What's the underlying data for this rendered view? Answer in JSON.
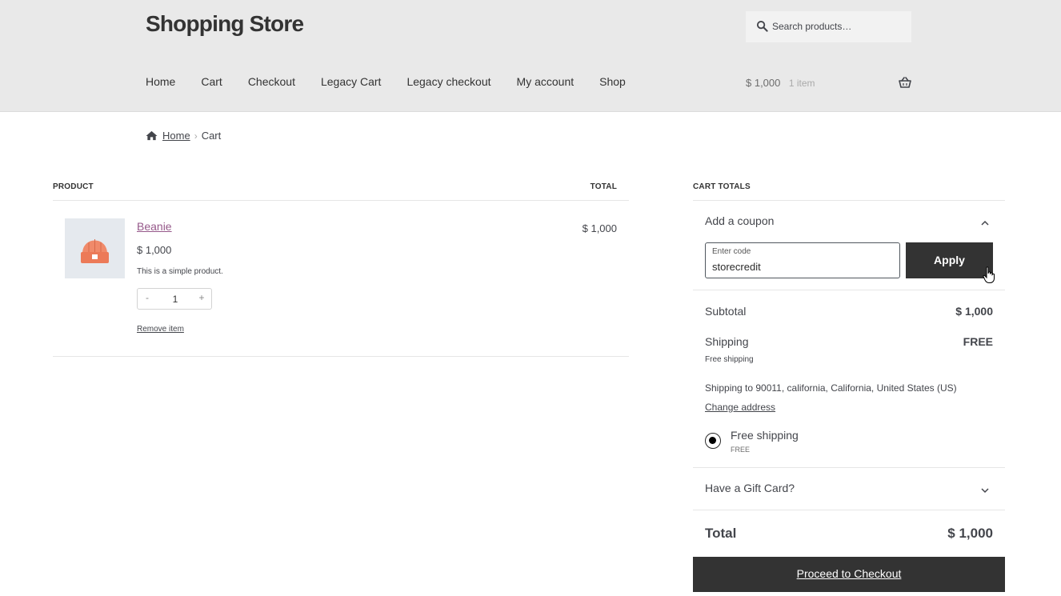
{
  "header": {
    "site_title": "Shopping Store",
    "search_placeholder": "Search products…",
    "nav": [
      "Home",
      "Cart",
      "Checkout",
      "Legacy Cart",
      "Legacy checkout",
      "My account",
      "Shop"
    ],
    "mini_cart_amount": "$ 1,000",
    "mini_cart_count": "1 item"
  },
  "breadcrumb": {
    "home": "Home",
    "current": "Cart"
  },
  "cart": {
    "col_product": "PRODUCT",
    "col_total": "TOTAL",
    "item": {
      "name": "Beanie",
      "price": "$ 1,000",
      "description": "This is a simple product.",
      "quantity": "1",
      "minus": "-",
      "plus": "+",
      "remove_label": "Remove item",
      "line_total": "$ 1,000"
    }
  },
  "totals": {
    "title": "CART TOTALS",
    "coupon_label": "Add a coupon",
    "code_label": "Enter code",
    "code_value": "storecredit",
    "apply_label": "Apply",
    "subtotal_label": "Subtotal",
    "subtotal_value": "$ 1,000",
    "shipping_label": "Shipping",
    "shipping_value": "FREE",
    "shipping_method": "Free shipping",
    "shipping_to": "Shipping to 90011, california, California, United States (US)",
    "change_address": "Change address",
    "radio_label": "Free shipping",
    "radio_sub": "FREE",
    "gift_card_label": "Have a Gift Card?",
    "total_label": "Total",
    "total_value": "$ 1,000",
    "checkout_label": "Proceed to Checkout"
  },
  "colors": {
    "accent_link": "#96588a",
    "dark_button": "#333333",
    "header_bg": "#e9e9e9"
  }
}
